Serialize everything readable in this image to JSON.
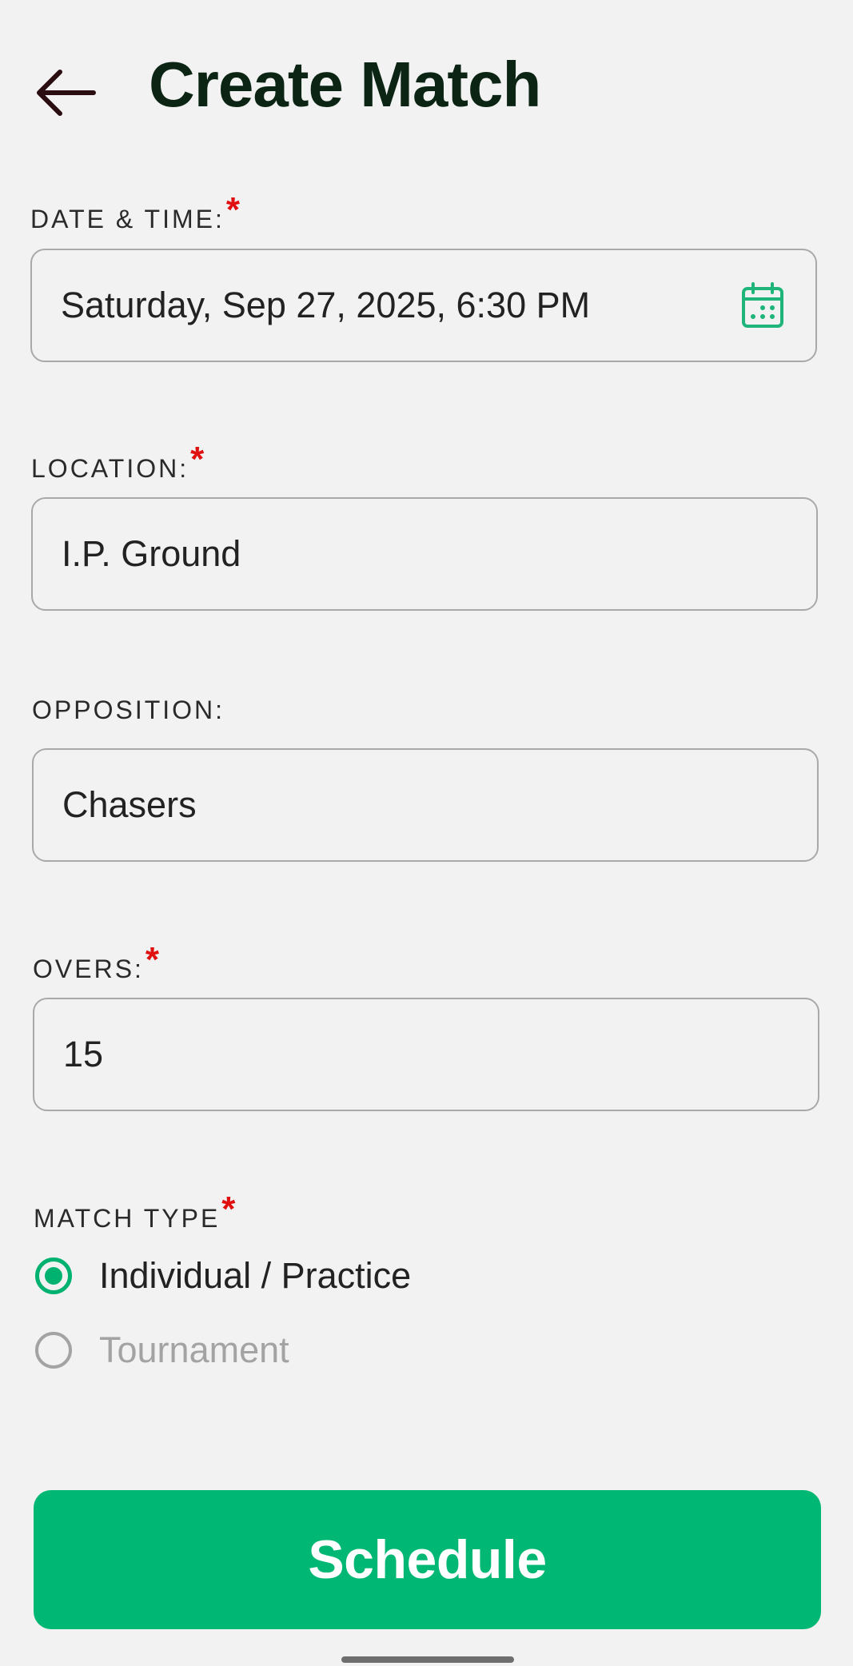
{
  "header": {
    "title": "Create Match",
    "back_icon": "arrow-left-icon"
  },
  "form": {
    "date_time": {
      "label": "DATE & TIME:",
      "required_mark": "*",
      "value": "Saturday, Sep 27, 2025, 6:30 PM",
      "icon": "calendar-icon"
    },
    "location": {
      "label": "LOCATION:",
      "required_mark": "*",
      "value": "I.P. Ground"
    },
    "opposition": {
      "label": "OPPOSITION:",
      "value": "Chasers"
    },
    "overs": {
      "label": "OVERS:",
      "required_mark": "*",
      "value": "15"
    },
    "match_type": {
      "label": "MATCH TYPE",
      "required_mark": "*",
      "options": [
        {
          "label": "Individual / Practice",
          "selected": true
        },
        {
          "label": "Tournament",
          "selected": false
        }
      ]
    }
  },
  "actions": {
    "schedule_label": "Schedule"
  },
  "colors": {
    "accent": "#00b874",
    "required": "#e01010",
    "title": "#0b2414",
    "background": "#f2f2f2"
  }
}
